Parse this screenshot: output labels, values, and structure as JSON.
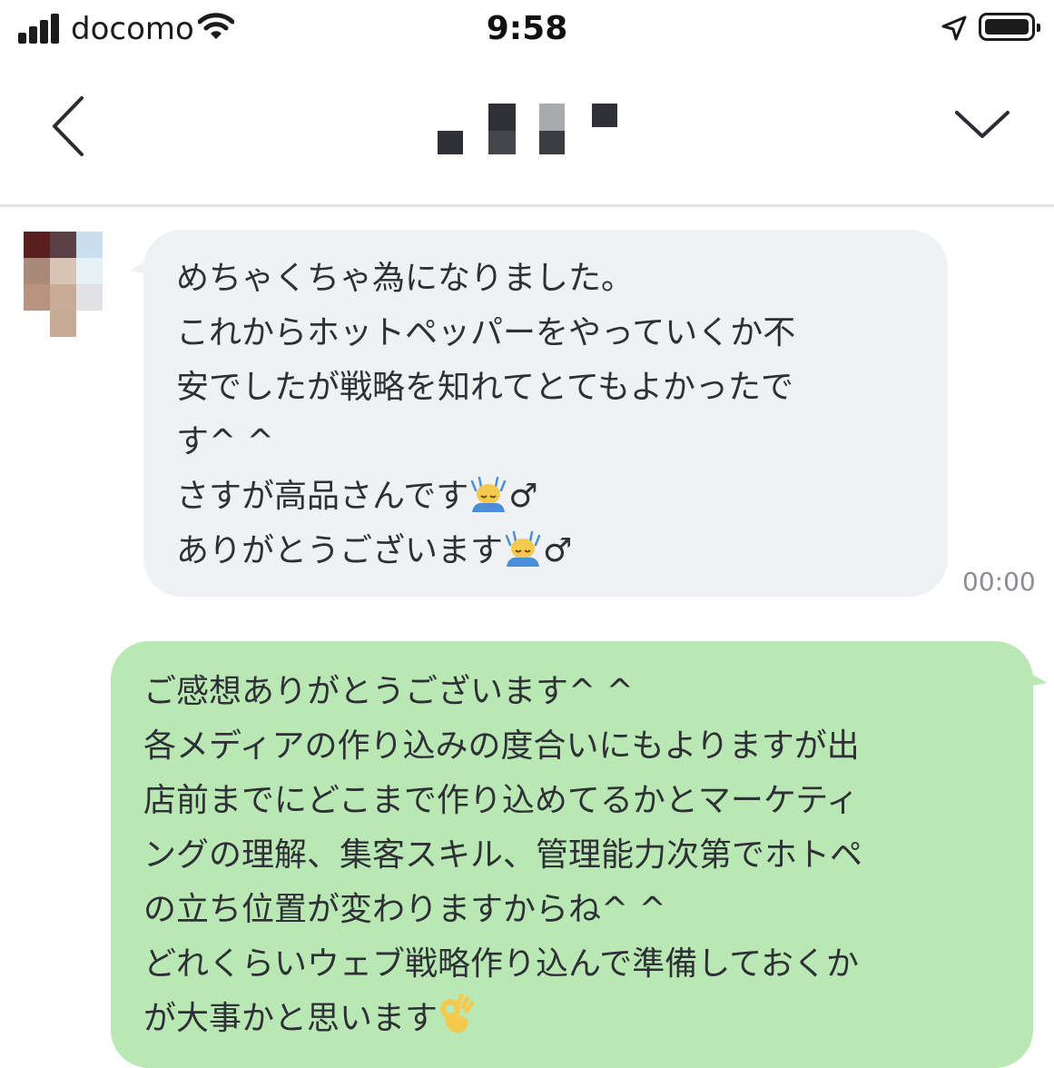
{
  "status_bar": {
    "carrier": "docomo",
    "time": "9:58",
    "icons": [
      "signal-icon",
      "wifi-icon",
      "location-arrow-icon",
      "battery-icon"
    ]
  },
  "header": {
    "contact_name": "",
    "back_icon": "chevron-left-icon",
    "menu_icon": "chevron-down-icon"
  },
  "messages": [
    {
      "direction": "incoming",
      "lines": [
        "めちゃくちゃ為になりました。",
        "これからホットペッパーをやっていくか不",
        "安でしたが戦略を知れてとてもよかったで",
        "す^ ^",
        "さすが高品さんです",
        "ありがとうございます"
      ],
      "emoji_suffix": "♂",
      "timestamp": "00:00"
    },
    {
      "direction": "outgoing",
      "lines": [
        "ご感想ありがとうございます^ ^",
        "各メディアの作り込みの度合いにもよりますが出",
        "店前までにどこまで作り込めてるかとマーケティ",
        "ングの理解、集客スキル、管理能力次第でホトペ",
        "の立ち位置が変わりますからね^ ^",
        "どれくらいウェブ戦略作り込んで準備しておくか",
        "が大事かと思います"
      ]
    }
  ],
  "colors": {
    "incoming_bubble": "#f0f1f3",
    "outgoing_bubble": "#b9e8b4",
    "text": "#2e3036",
    "timestamp": "#8a8d93"
  }
}
